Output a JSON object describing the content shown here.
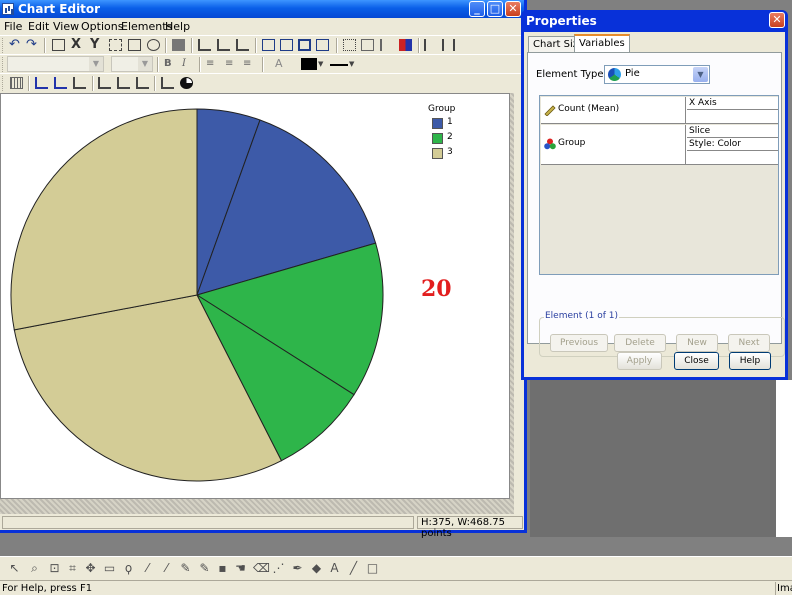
{
  "chart_editor": {
    "title": "Chart Editor",
    "menu": [
      "File",
      "Edit",
      "View",
      "Options",
      "Elements",
      "Help"
    ],
    "status_dims": "H:375, W:468.75 points"
  },
  "chart": {
    "legend_title": "Group",
    "annotation": "20"
  },
  "chart_data": {
    "type": "pie",
    "legend_title": "Group",
    "categories": [
      "1",
      "2",
      "3"
    ],
    "values": [
      24,
      22,
      54
    ],
    "slices": [
      {
        "group": "1",
        "percent": 5.5
      },
      {
        "group": "1",
        "percent": 15.0
      },
      {
        "group": "2",
        "percent": 13.5
      },
      {
        "group": "2",
        "percent": 8.5
      },
      {
        "group": "3",
        "percent": 29.5
      },
      {
        "group": "3",
        "percent": 28.0
      }
    ],
    "colors": {
      "1": "#3d5aa8",
      "2": "#2eb54a",
      "3": "#d3cc96"
    },
    "annotations": [
      "20"
    ]
  },
  "properties": {
    "title": "Properties",
    "tabs": [
      "Chart Size",
      "Variables"
    ],
    "active_tab": "Variables",
    "element_type_label": "Element Type:",
    "element_type_value": "Pie",
    "variables": [
      {
        "name": "Count (Mean)",
        "slots": [
          "X Axis",
          ""
        ]
      },
      {
        "name": "Group",
        "slots": [
          "Slice",
          "Style: Color",
          ""
        ]
      }
    ],
    "element_group_label": "Element (1 of 1)",
    "element_buttons": [
      "Previous",
      "Delete",
      "New",
      "Next"
    ],
    "dialog_buttons": [
      "Apply",
      "Close",
      "Help"
    ]
  },
  "app_status": {
    "help": "For Help, press F1",
    "right": "Imag"
  }
}
